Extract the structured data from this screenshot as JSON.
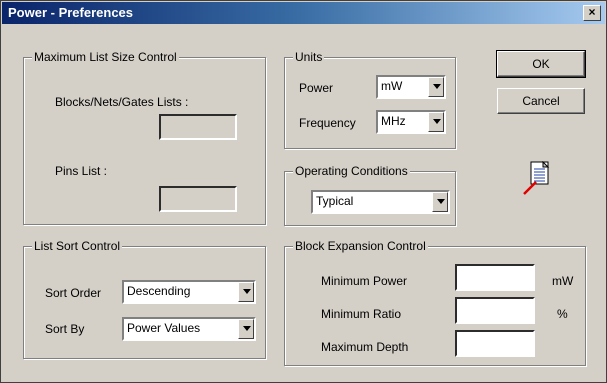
{
  "window": {
    "title": "Power - Preferences",
    "close_glyph": "×"
  },
  "max_list": {
    "legend": "Maximum List Size Control",
    "blocks_label": "Blocks/Nets/Gates Lists :",
    "blocks_value": "",
    "pins_label": "Pins List :",
    "pins_value": ""
  },
  "units": {
    "legend": "Units",
    "power_label": "Power",
    "power_value": "mW",
    "frequency_label": "Frequency",
    "frequency_value": "MHz"
  },
  "buttons": {
    "ok": "OK",
    "cancel": "Cancel"
  },
  "operating": {
    "legend": "Operating Conditions",
    "value": "Typical"
  },
  "sort": {
    "legend": "List Sort Control",
    "order_label": "Sort Order",
    "order_value": "Descending",
    "by_label": "Sort By",
    "by_value": "Power Values"
  },
  "block_expansion": {
    "legend": "Block Expansion Control",
    "min_power_label": "Minimum Power",
    "min_power_value": "",
    "min_power_unit": "mW",
    "min_ratio_label": "Minimum Ratio",
    "min_ratio_value": "",
    "min_ratio_unit": "%",
    "max_depth_label": "Maximum Depth",
    "max_depth_value": ""
  },
  "icons": {
    "notepad": "notepad-icon"
  }
}
